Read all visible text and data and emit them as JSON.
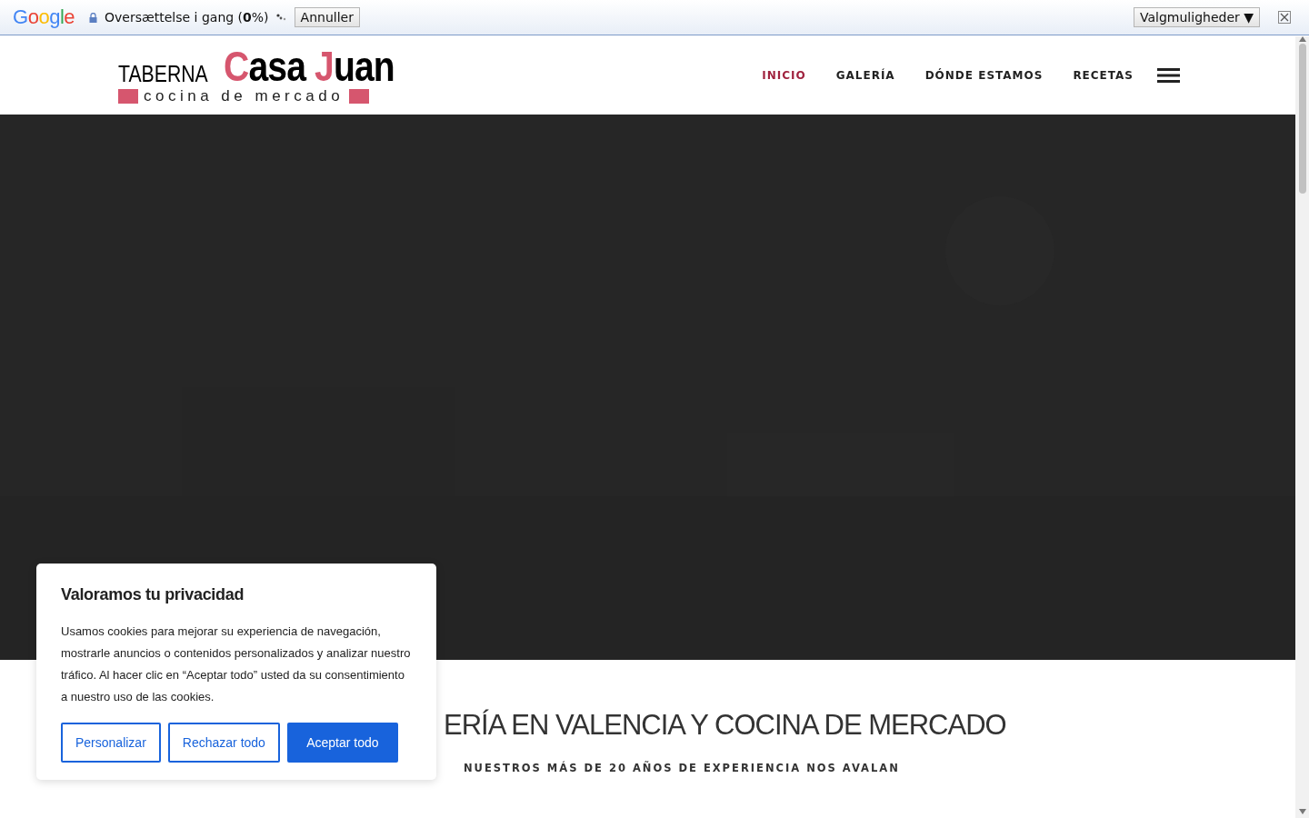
{
  "translate_bar": {
    "logo": "Google",
    "status": "Oversættelse i gang (**0**%)",
    "cancel_button": "Annuller",
    "options_button": "Valgmuligheder ▼"
  },
  "logo": {
    "prefix": "TABERNA",
    "name_1": "Casa",
    "name_2": "Juan",
    "tagline": "cocina de mercado"
  },
  "nav": [
    {
      "label": "INICIO",
      "selected": true
    },
    {
      "label": "GALERÍA",
      "selected": false
    },
    {
      "label": "DÓNDE ESTAMOS",
      "selected": false
    },
    {
      "label": "RECETAS",
      "selected": false
    }
  ],
  "section": {
    "heading": "ERÍA EN VALENCIA Y COCINA DE MERCADO",
    "subheading": "NUESTROS MÁS DE 20 AÑOS DE EXPERIENCIA NOS AVALAN"
  },
  "cookie_banner": {
    "title": "Valoramos tu privacidad",
    "text": "Usamos cookies para mejorar su experiencia de navegación, mostrarle anuncios o contenidos personalizados y analizar nuestro tráfico. Al hacer clic en “Aceptar todo” usted da su consentimiento a nuestro uso de las cookies.",
    "buttons": [
      {
        "label": "Personalizar",
        "kind": "outline"
      },
      {
        "label": "Rechazar todo",
        "kind": "outline"
      },
      {
        "label": "Aceptar todo",
        "kind": "primary"
      }
    ]
  }
}
